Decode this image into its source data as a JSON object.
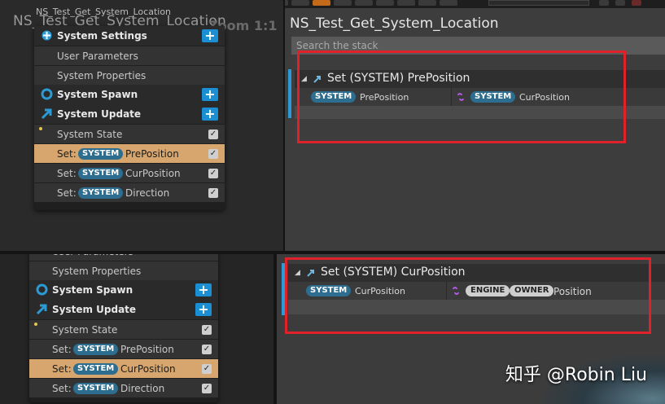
{
  "emitter_title": "NS_Test_Get_System_Location",
  "zoom_label": "Zoom 1:1",
  "node_stub_label": "NS_Test_Get_System_Location",
  "node_top": {
    "rows": [
      {
        "kind": "cat",
        "label": "System Settings",
        "icon": "settings-icon",
        "plus": true
      },
      {
        "kind": "item",
        "label": "User Parameters"
      },
      {
        "kind": "item",
        "label": "System Properties"
      },
      {
        "kind": "cat",
        "label": "System Spawn",
        "icon": "spawn-icon",
        "plus": true
      },
      {
        "kind": "cat",
        "label": "System Update",
        "icon": "update-icon",
        "plus": true
      },
      {
        "kind": "item",
        "label": "System State",
        "check": true,
        "dot": true
      },
      {
        "kind": "set",
        "set_label": "Set:",
        "pill": "SYSTEM",
        "label": "PrePosition",
        "check": true,
        "selected": true
      },
      {
        "kind": "set",
        "set_label": "Set:",
        "pill": "SYSTEM",
        "label": "CurPosition",
        "check": true
      },
      {
        "kind": "set",
        "set_label": "Set:",
        "pill": "SYSTEM",
        "label": "Direction",
        "check": true
      }
    ]
  },
  "node_bot": {
    "rows": [
      {
        "kind": "item",
        "label": "User Parameters"
      },
      {
        "kind": "item",
        "label": "System Properties"
      },
      {
        "kind": "cat",
        "label": "System Spawn",
        "icon": "spawn-icon",
        "plus": true
      },
      {
        "kind": "cat",
        "label": "System Update",
        "icon": "update-icon",
        "plus": true
      },
      {
        "kind": "item",
        "label": "System State",
        "check": true,
        "dot": true
      },
      {
        "kind": "set",
        "set_label": "Set:",
        "pill": "SYSTEM",
        "label": "PrePosition",
        "check": true
      },
      {
        "kind": "set",
        "set_label": "Set:",
        "pill": "SYSTEM",
        "label": "CurPosition",
        "check": true,
        "selected": true
      },
      {
        "kind": "set",
        "set_label": "Set:",
        "pill": "SYSTEM",
        "label": "Direction",
        "check": true
      }
    ]
  },
  "stack_top": {
    "title": "NS_Test_Get_System_Location",
    "search_placeholder": "Search the stack",
    "module_title": "Set (SYSTEM) PrePosition",
    "left_pill": "SYSTEM",
    "left_label": "PrePosition",
    "right_pill": "SYSTEM",
    "right_label": "CurPosition"
  },
  "stack_bot": {
    "module_title": "Set (SYSTEM) CurPosition",
    "left_pill": "SYSTEM",
    "left_label": "CurPosition",
    "right_pill_1": "ENGINE",
    "right_pill_2": "OWNER",
    "right_label": "Position"
  },
  "watermark": "知乎 @Robin Liu",
  "colors": {
    "accent": "#2b9bd6",
    "pill_system": "#2d6d8f",
    "selected_row": "#d6a66e",
    "highlight_box": "#e0202a",
    "plus_button": "#1a8fd4"
  }
}
